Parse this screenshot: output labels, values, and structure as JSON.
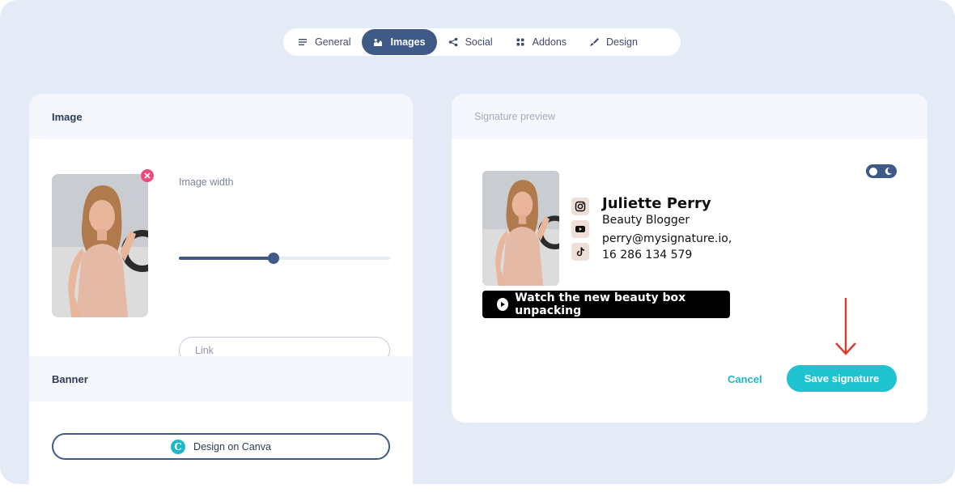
{
  "tabs": [
    {
      "label": "General",
      "icon": "list-icon",
      "active": false
    },
    {
      "label": "Images",
      "icon": "image-icon",
      "active": true
    },
    {
      "label": "Social",
      "icon": "share-icon",
      "active": false
    },
    {
      "label": "Addons",
      "icon": "grid-icon",
      "active": false
    },
    {
      "label": "Design",
      "icon": "brush-icon",
      "active": false
    }
  ],
  "image_section": {
    "title": "Image",
    "width_label": "Image width",
    "width_value_fraction": 0.45,
    "link_placeholder": "Link"
  },
  "banner_section": {
    "title": "Banner",
    "canva_button_label": "Design on Canva",
    "canva_icon_letter": "C"
  },
  "preview": {
    "title": "Signature preview",
    "name": "Juliette Perry",
    "role": "Beauty Blogger",
    "email": "perry@mysignature.io,",
    "phone": "16 286 134 579",
    "socials": [
      "instagram-icon",
      "youtube-icon",
      "tiktok-icon"
    ],
    "video_button_label": "Watch the new beauty box unpacking",
    "cancel_label": "Cancel",
    "save_label": "Save signature"
  },
  "colors": {
    "page_bg": "#e4ebf6",
    "accent_dark": "#3f5a86",
    "accent_teal": "#1fc2cf",
    "remove_pink": "#ee4a7b",
    "arrow_red": "#d93a2b"
  }
}
